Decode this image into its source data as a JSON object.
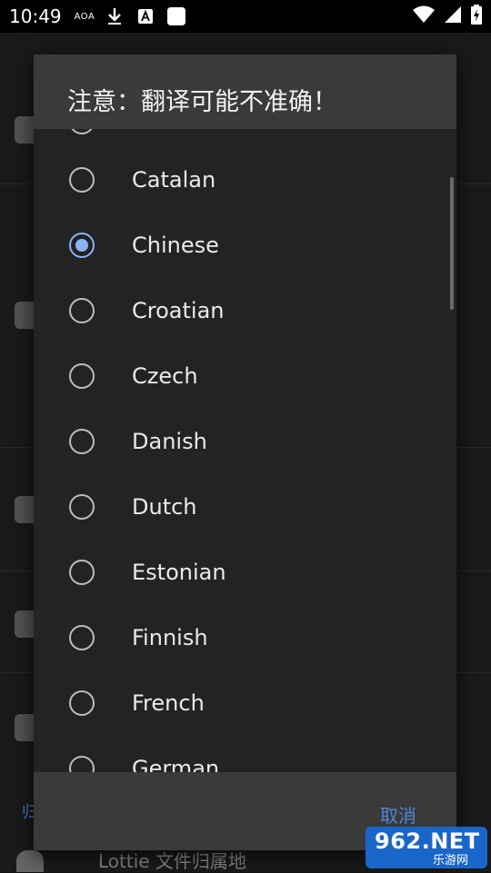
{
  "status_bar": {
    "time": "10:49",
    "aoa": "AOA"
  },
  "background": {
    "section_label": "归",
    "bottom_item": "Lottie 文件归属地"
  },
  "dialog": {
    "title": "注意：翻译可能不准确！",
    "cancel_label": "取消",
    "selected": "Chinese",
    "items": [
      {
        "label": "Catalan",
        "checked": false
      },
      {
        "label": "Chinese",
        "checked": true
      },
      {
        "label": "Croatian",
        "checked": false
      },
      {
        "label": "Czech",
        "checked": false
      },
      {
        "label": "Danish",
        "checked": false
      },
      {
        "label": "Dutch",
        "checked": false
      },
      {
        "label": "Estonian",
        "checked": false
      },
      {
        "label": "Finnish",
        "checked": false
      },
      {
        "label": "French",
        "checked": false
      },
      {
        "label": "German",
        "checked": false
      }
    ]
  },
  "watermark": {
    "main": "962.NET",
    "sub": "乐游网"
  },
  "colors": {
    "accent": "#8ab4f8",
    "button": "#4f86d9",
    "dialog_bg": "#232323",
    "header_bg": "#3a3a3a"
  }
}
